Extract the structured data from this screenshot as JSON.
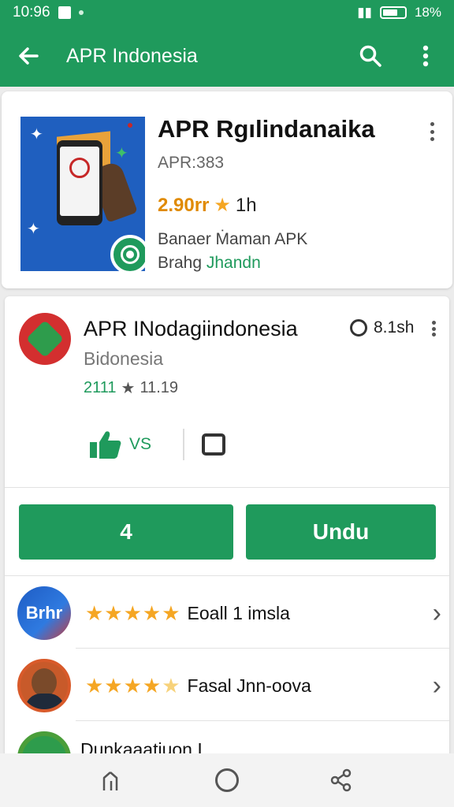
{
  "status_bar": {
    "time": "10:96",
    "right_text": "18%"
  },
  "app_bar": {
    "title": "APR Indonesia",
    "back_icon": "arrow-left-icon",
    "search_icon": "search-icon",
    "menu_icon": "more-vert-icon"
  },
  "featured": {
    "title": "APR Rgılindanaika",
    "subtitle": "APR:383",
    "rating": "2.90rr",
    "rating_extra": "1h",
    "description": "Banaer Ṁaman APK",
    "category_prefix": "Brahg ",
    "category_link": "Jhandn"
  },
  "app": {
    "title": "APR INodagiindonesia",
    "developer": "Bidonesia",
    "rating": "2111",
    "rating_extra": "11.19",
    "meta": "8.1sh",
    "like_label": "VS",
    "colors": {
      "accent": "#1f9a5c",
      "icon_bg": "#d32f2f"
    }
  },
  "buttons": {
    "left": "4",
    "right": "Undu"
  },
  "reviews": [
    {
      "avatar": "Brhr",
      "stars": "★★★★★",
      "label": "Eoall 1 imsla"
    },
    {
      "avatar": "",
      "stars": "★★★★",
      "half_star": "★",
      "label": "Fasal Jnn-oova"
    }
  ],
  "partial_row": {
    "label": "Dunkaaatiuon I"
  }
}
